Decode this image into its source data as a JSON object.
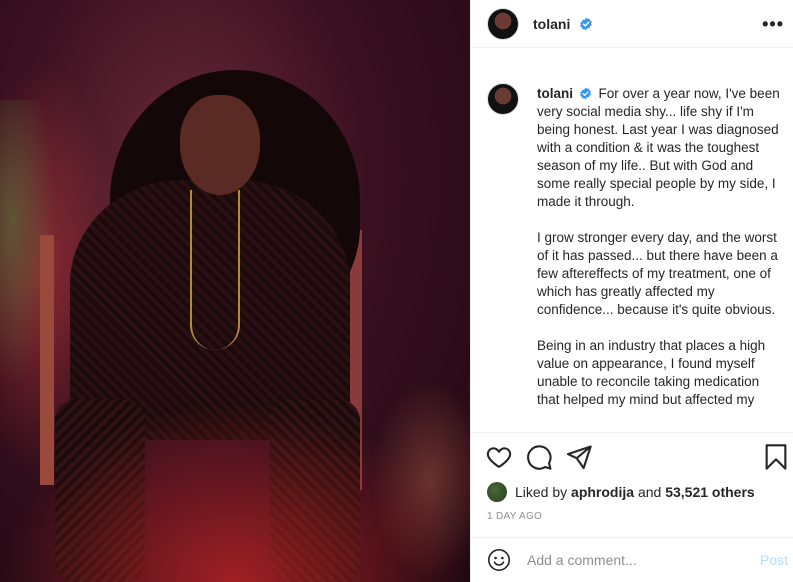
{
  "header": {
    "username": "tolani",
    "verified": true,
    "more_label": "•••"
  },
  "caption": {
    "username": "tolani",
    "paragraphs": [
      "For over a year now, I've been very social media shy... life shy if I'm being honest. Last year I was diagnosed with a condition & it was the toughest season of my life.. But with God and some really special people by my side, I made it through.",
      "I grow stronger every day, and the worst of it has passed... but there have been a few aftereffects of my treatment, one of which has greatly affected my confidence... because it's quite obvious.",
      "Being in an industry that places a high value on appearance, I found myself unable to reconcile taking medication that helped my mind but affected my"
    ]
  },
  "actions": {
    "like_icon": "heart-icon",
    "comment_icon": "comment-icon",
    "share_icon": "paper-plane-icon",
    "save_icon": "bookmark-icon"
  },
  "likes": {
    "prefix": "Liked by ",
    "user": "aphrodija",
    "middle": " and ",
    "count": "53,521 others"
  },
  "timestamp": "1 DAY AGO",
  "comment": {
    "placeholder": "Add a comment...",
    "post_label": "Post"
  },
  "colors": {
    "verified": "#3897f0",
    "post_disabled": "#b3dbff",
    "muted": "#8e8e8e"
  }
}
